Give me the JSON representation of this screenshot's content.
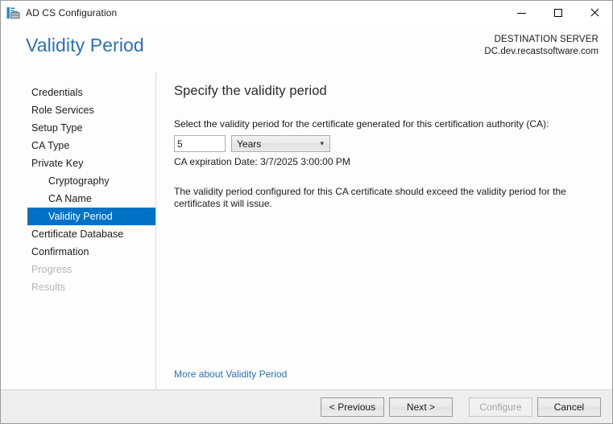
{
  "window": {
    "title": "AD CS Configuration",
    "icon": "server-manager-icon",
    "controls": {
      "minimize": "minimize-icon",
      "maximize": "maximize-icon",
      "close": "close-icon"
    }
  },
  "header": {
    "page_title": "Validity Period",
    "destination_label": "DESTINATION SERVER",
    "destination_server": "DC.dev.recastsoftware.com"
  },
  "sidebar": {
    "items": [
      {
        "label": "Credentials",
        "level": 0,
        "state": "enabled"
      },
      {
        "label": "Role Services",
        "level": 0,
        "state": "enabled"
      },
      {
        "label": "Setup Type",
        "level": 0,
        "state": "enabled"
      },
      {
        "label": "CA Type",
        "level": 0,
        "state": "enabled"
      },
      {
        "label": "Private Key",
        "level": 0,
        "state": "enabled"
      },
      {
        "label": "Cryptography",
        "level": 1,
        "state": "enabled"
      },
      {
        "label": "CA Name",
        "level": 1,
        "state": "enabled"
      },
      {
        "label": "Validity Period",
        "level": 1,
        "state": "selected"
      },
      {
        "label": "Certificate Database",
        "level": 0,
        "state": "enabled"
      },
      {
        "label": "Confirmation",
        "level": 0,
        "state": "enabled"
      },
      {
        "label": "Progress",
        "level": 0,
        "state": "disabled"
      },
      {
        "label": "Results",
        "level": 0,
        "state": "disabled"
      }
    ]
  },
  "main": {
    "title": "Specify the validity period",
    "field_label": "Select the validity period for the certificate generated for this certification authority (CA):",
    "period_value": "5",
    "period_unit": "Years",
    "select_arrow": "chevron-down-icon",
    "expiration_text": "CA expiration Date: 3/7/2025 3:00:00 PM",
    "note": "The validity period configured for this CA certificate should exceed the validity period for the certificates it will issue.",
    "more_link": "More about Validity Period"
  },
  "footer": {
    "previous": "< Previous",
    "next": "Next >",
    "configure": "Configure",
    "cancel": "Cancel"
  },
  "colors": {
    "accent": "#0072c6",
    "link": "#2a72b5",
    "title": "#2a72b5",
    "footer_bg": "#eeeeee",
    "disabled_text": "#b4b4b4"
  }
}
